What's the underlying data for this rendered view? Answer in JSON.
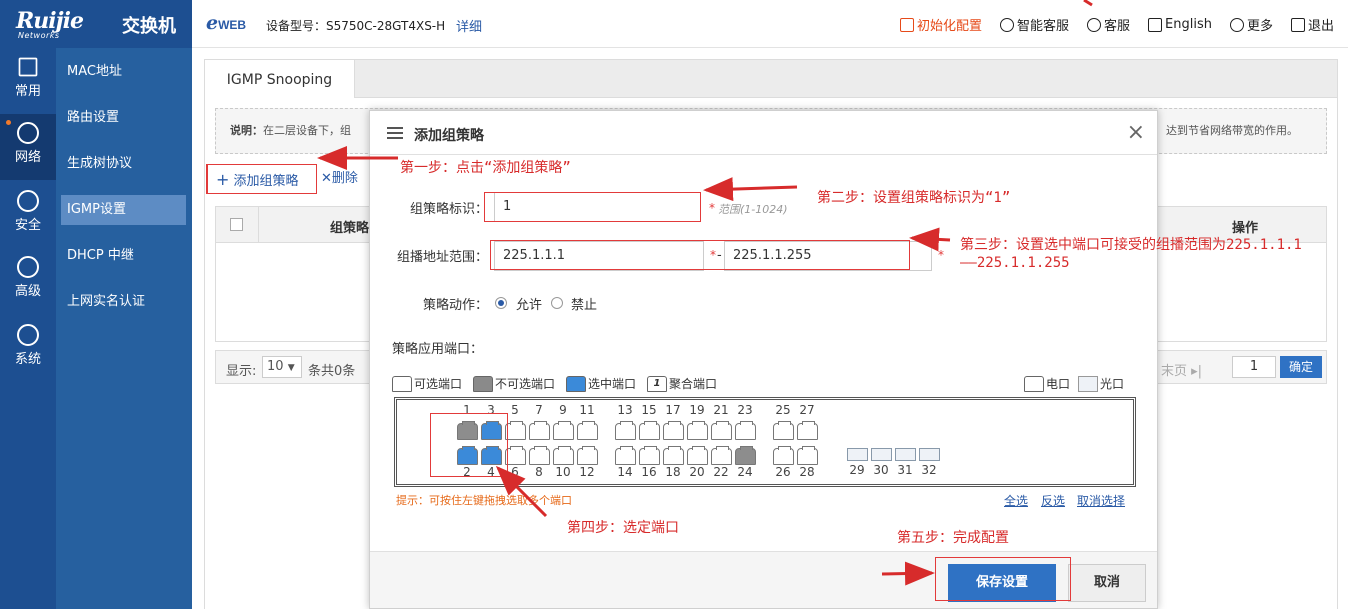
{
  "header": {
    "logo": "Ruijie",
    "logo_sub": "Networks",
    "product": "交换机",
    "eweb": "e",
    "eweb_suffix": "WEB",
    "model_label": "设备型号：S5750C-28GT4XS-H",
    "detail": "详细",
    "nav": [
      {
        "label": "初始化配置",
        "icon": "init-config-icon"
      },
      {
        "label": "智能客服",
        "icon": "smart-service-icon"
      },
      {
        "label": "客服",
        "icon": "service-icon"
      },
      {
        "label": "English",
        "icon": "language-icon"
      },
      {
        "label": "更多",
        "icon": "more-icon"
      },
      {
        "label": "退出",
        "icon": "logout-icon"
      }
    ]
  },
  "sidebar": {
    "icons": [
      {
        "label": "常用",
        "icon": "home-icon"
      },
      {
        "label": "网络",
        "icon": "network-icon"
      },
      {
        "label": "安全",
        "icon": "shield-icon"
      },
      {
        "label": "高级",
        "icon": "advanced-icon"
      },
      {
        "label": "系统",
        "icon": "gear-icon"
      }
    ],
    "submenu": [
      "MAC地址",
      "路由设置",
      "生成树协议",
      "IGMP设置",
      "DHCP 中继",
      "上网实名认证"
    ]
  },
  "main": {
    "tab": "IGMP Snooping",
    "notice_label": "说明：",
    "notice_text": "在二层设备下，组",
    "notice_tail": "达到节省网络带宽的作用。",
    "add_button": "添加组策略",
    "delete_button": "删除",
    "table_header_1": "组策略",
    "table_header_op": "操作",
    "pager": {
      "show": "显示:",
      "page_size": "10",
      "total": "条共0条",
      "last": "末页",
      "page": "1",
      "confirm": "确定"
    }
  },
  "modal": {
    "title": "添加组策略",
    "close": "×",
    "id_label": "组策略标识：",
    "id_value": "1",
    "id_hint": "范围(1-1024)",
    "range_label": "组播地址范围：",
    "range_start": "225.1.1.1",
    "range_sep": "-",
    "range_end": "225.1.1.255",
    "action_label": "策略动作：",
    "allow": "允许",
    "deny": "禁止",
    "ports_label": "策略应用端口：",
    "legend": {
      "selectable": "可选端口",
      "unselectable": "不可选端口",
      "selected": "选中端口",
      "aggregated": "聚合端口",
      "agg_num": "1",
      "copper": "电口",
      "fiber": "光口"
    },
    "top_ports": [
      "1",
      "3",
      "5",
      "7",
      "9",
      "11",
      "13",
      "15",
      "17",
      "19",
      "21",
      "23",
      "25",
      "27"
    ],
    "bottom_ports": [
      "2",
      "4",
      "6",
      "8",
      "10",
      "12",
      "14",
      "16",
      "18",
      "20",
      "22",
      "24",
      "26",
      "28"
    ],
    "fiber_ports": [
      "29",
      "30",
      "31",
      "32"
    ],
    "tip": "提示：可按住左键拖拽选取多个端口",
    "select_all": "全选",
    "invert": "反选",
    "clear": "取消选择",
    "save": "保存设置",
    "cancel": "取消"
  },
  "annotations": {
    "step1": "第一步：点击“添加组策略”",
    "step2": "第二步：设置组策略标识为“1”",
    "step3_line1": "第三步：设置选中端口可接受的组播范围为225.1.1.1",
    "step3_line2": "——225.1.1.255",
    "step4": "第四步：选定端口",
    "step5": "第五步：完成配置"
  },
  "colors": {
    "sidebar": "#1d4f91",
    "submenu": "#26609f",
    "accent": "#2f72c4",
    "annotation": "#d72b2b",
    "selected_port": "#3b8ad9"
  }
}
